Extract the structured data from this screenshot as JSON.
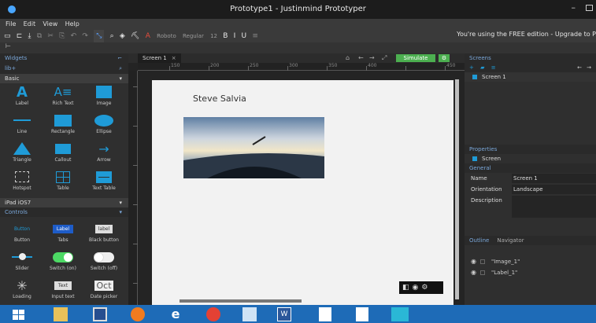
{
  "window": {
    "title": "Prototype1 - Justinmind Prototyper"
  },
  "menu": {
    "file": "File",
    "edit": "Edit",
    "view": "View",
    "help": "Help"
  },
  "toolbar": {
    "font_name": "Roboto",
    "font_style": "Regular",
    "font_size": "12",
    "bold": "B",
    "italic": "I",
    "underline": "U",
    "free_notice": "You're using the FREE edition - Upgrade to P"
  },
  "widgets": {
    "title": "Widgets",
    "basic_section": "Basic",
    "ipad_section": "iPad iOS7",
    "controls_section": "Controls",
    "basic_items": [
      {
        "label": "Label"
      },
      {
        "label": "Rich Text"
      },
      {
        "label": "Image"
      },
      {
        "label": "Line"
      },
      {
        "label": "Rectangle"
      },
      {
        "label": "Ellipse"
      },
      {
        "label": "Triangle"
      },
      {
        "label": "Callout"
      },
      {
        "label": "Arrow"
      },
      {
        "label": "Hotspot"
      },
      {
        "label": "Table"
      },
      {
        "label": "Text Table"
      }
    ],
    "controls_items": [
      {
        "label": "Button",
        "preview": "Button"
      },
      {
        "label": "Tabs",
        "preview": "Label"
      },
      {
        "label": "Black button",
        "preview": "label"
      },
      {
        "label": "Slider",
        "preview": ""
      },
      {
        "label": "Switch (on)",
        "preview": ""
      },
      {
        "label": "Switch (off)",
        "preview": ""
      },
      {
        "label": "Loading",
        "preview": ""
      },
      {
        "label": "Input text",
        "preview": "Text"
      },
      {
        "label": "Date picker",
        "preview": "Oct"
      }
    ]
  },
  "canvas": {
    "tab": "Screen 1",
    "simulate": "Simulate",
    "ruler_labels": [
      "150",
      "200",
      "250",
      "300",
      "350",
      "400",
      "450"
    ],
    "person_name": "Steve Salvia"
  },
  "screens": {
    "title": "Screens",
    "items": [
      "Screen 1"
    ]
  },
  "properties": {
    "title": "Properties",
    "selected": "Screen",
    "group": "General",
    "name_label": "Name",
    "name_value": "Screen 1",
    "orientation_label": "Orientation",
    "orientation_value": "Landscape",
    "description_label": "Description"
  },
  "outline": {
    "tab_outline": "Outline",
    "tab_navigator": "Navigator",
    "items": [
      "\"Image_1\"",
      "\"Label_1\""
    ]
  },
  "colors": {
    "accent": "#1f9bd7",
    "simulate": "#4caf50",
    "taskbar": "#1e6bb7"
  }
}
